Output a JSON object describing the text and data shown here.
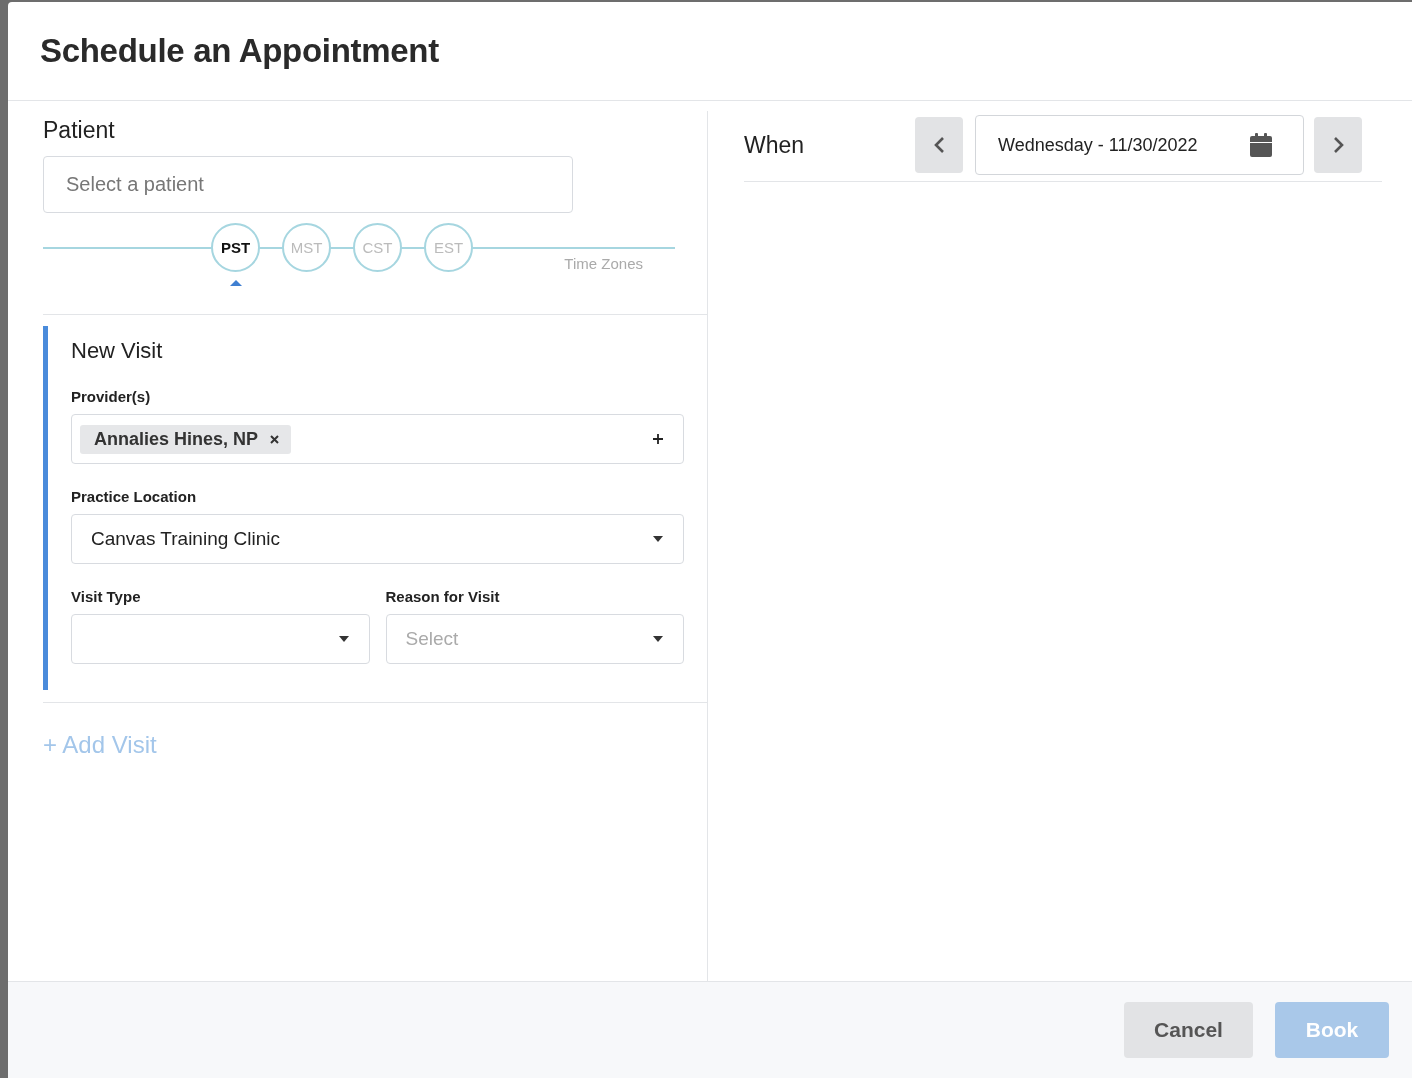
{
  "dialog": {
    "title": "Schedule an Appointment"
  },
  "patient": {
    "label": "Patient",
    "placeholder": "Select a patient"
  },
  "time_zones": {
    "label": "Time Zones",
    "zones": [
      {
        "label": "PST",
        "selected": true
      },
      {
        "label": "MST",
        "selected": false
      },
      {
        "label": "CST",
        "selected": false
      },
      {
        "label": "EST",
        "selected": false
      }
    ]
  },
  "visits": [
    {
      "title": "New Visit",
      "providers_label": "Provider(s)",
      "providers": [
        {
          "name": "Annalies Hines, NP"
        }
      ],
      "location_label": "Practice Location",
      "location": "Canvas Training Clinic",
      "visit_type_label": "Visit Type",
      "reason_label": "Reason for Visit",
      "reason_placeholder": "Select"
    }
  ],
  "add_visit": "+ Add Visit",
  "when": {
    "label": "When",
    "date": "Wednesday - 11/30/2022"
  },
  "buttons": [
    {
      "label": "Cancel",
      "kind": "secondary",
      "disabled": false
    },
    {
      "label": "Book",
      "kind": "primary",
      "disabled": true
    }
  ]
}
